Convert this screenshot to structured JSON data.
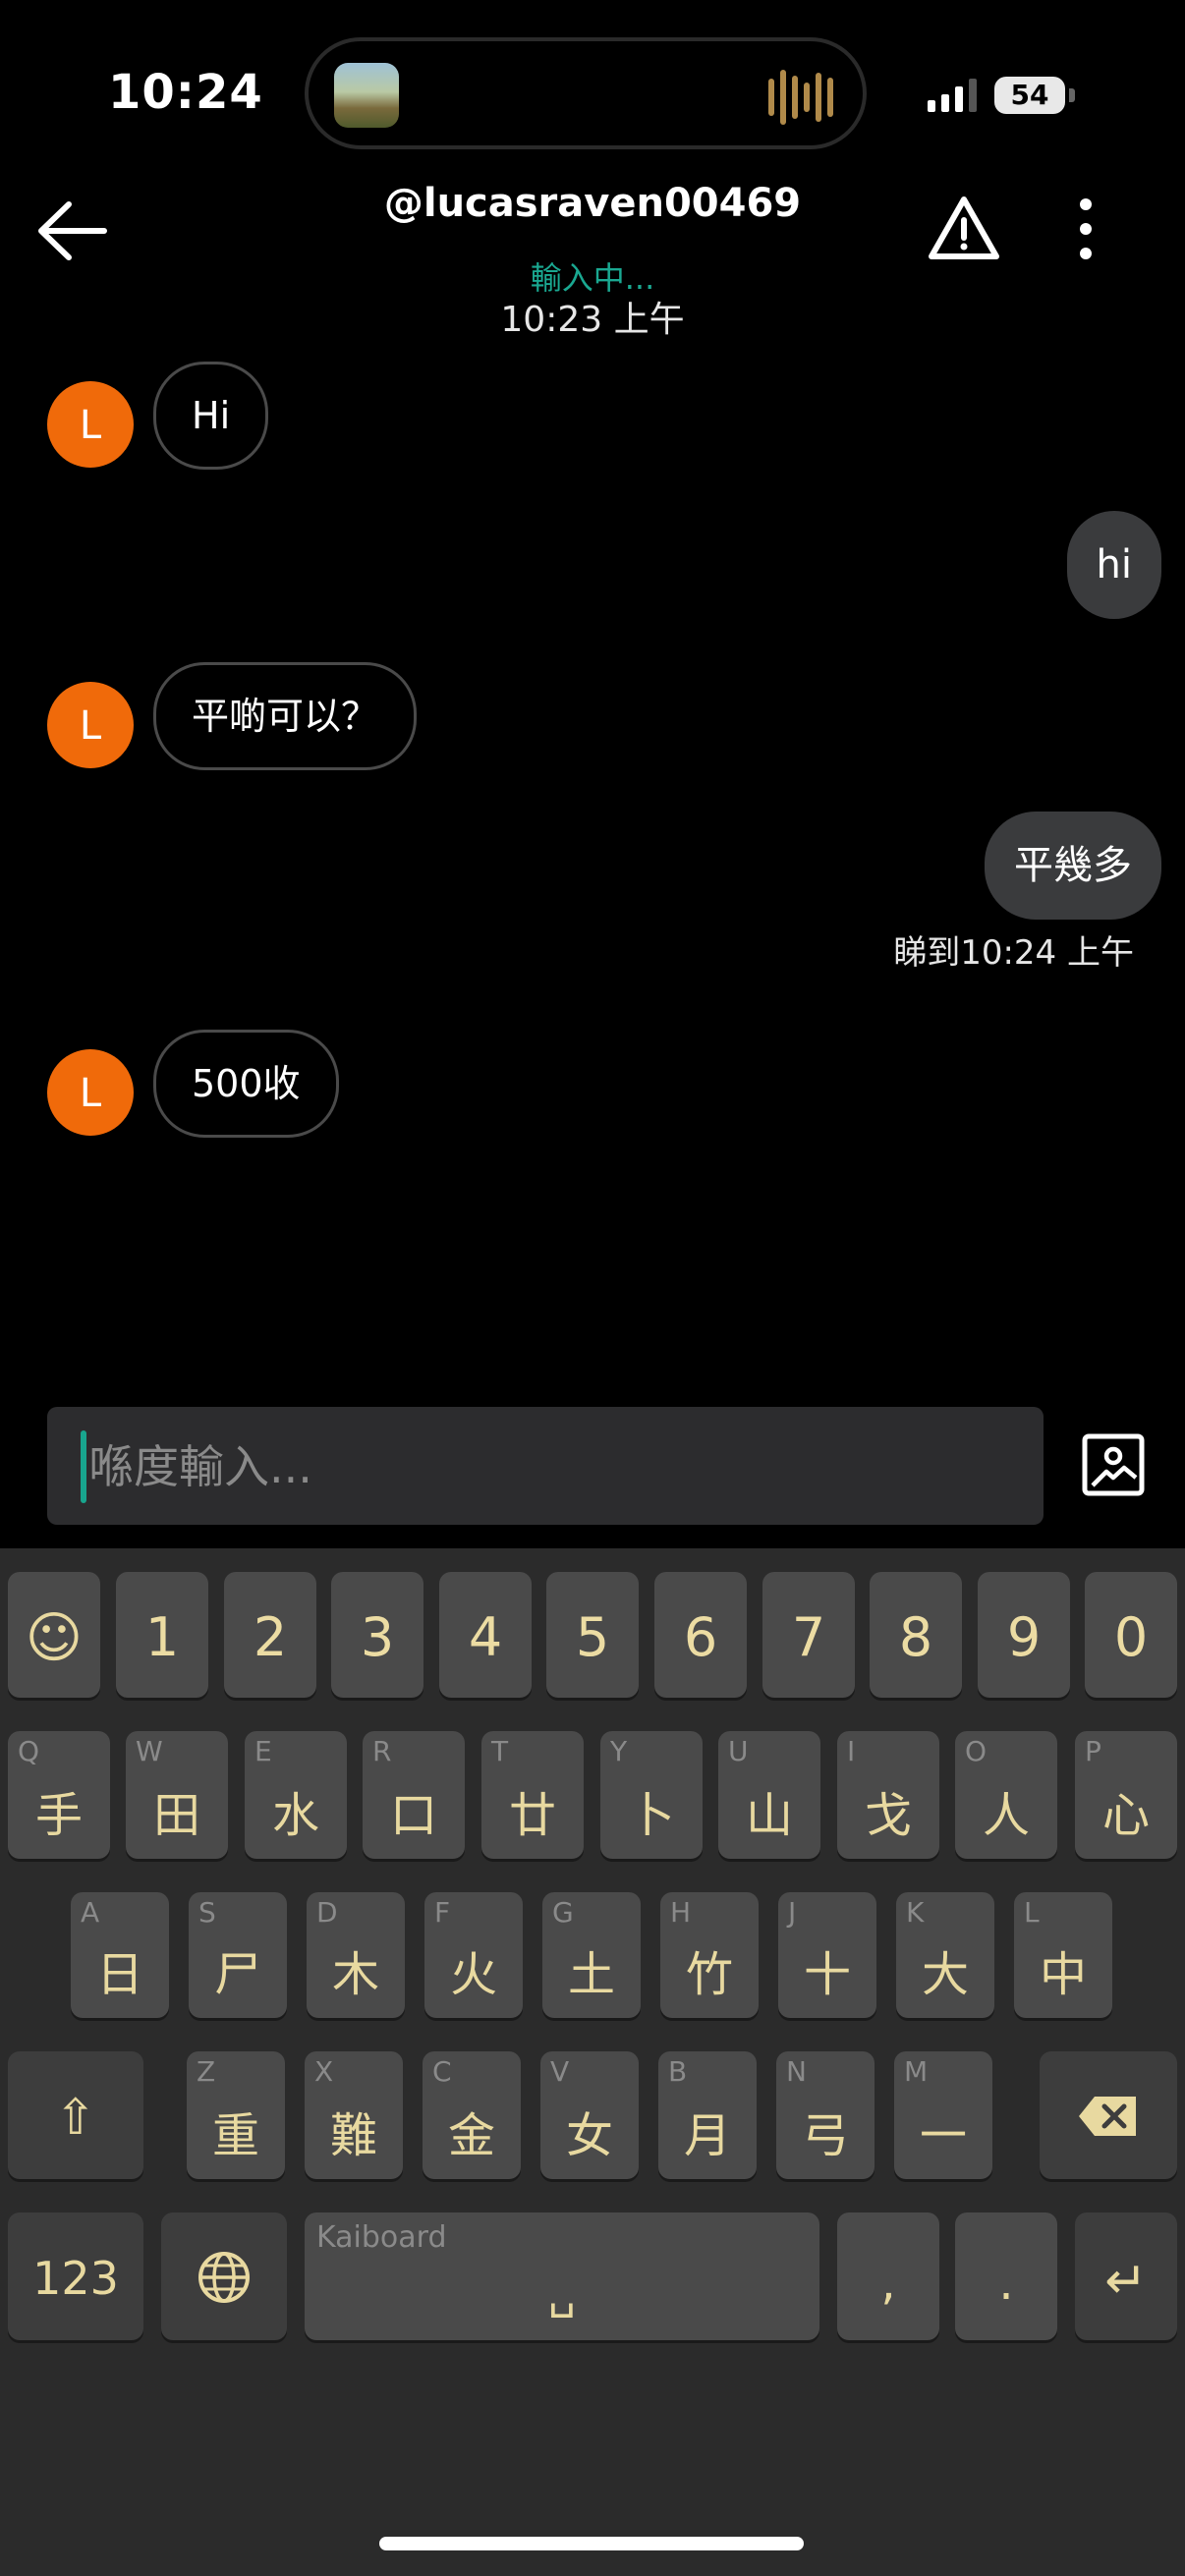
{
  "status_bar": {
    "time": "10:24",
    "battery": "54"
  },
  "header": {
    "title": "@lucasraven00469",
    "typing_status": "輸入中...",
    "timestamp": "10:23 上午"
  },
  "messages": [
    {
      "side": "in",
      "avatar": "L",
      "text": "Hi"
    },
    {
      "side": "out",
      "text": "hi"
    },
    {
      "side": "in",
      "avatar": "L",
      "text": "平啲可以？"
    },
    {
      "side": "out",
      "text": "平幾多"
    },
    {
      "side": "in",
      "avatar": "L",
      "text": "500收"
    }
  ],
  "read_receipt": "睇到10:24 上午",
  "composer": {
    "placeholder": "喺度輸入..."
  },
  "keyboard": {
    "emoji": "☺",
    "numbers": [
      "1",
      "2",
      "3",
      "4",
      "5",
      "6",
      "7",
      "8",
      "9",
      "0"
    ],
    "row1": [
      {
        "alt": "Q",
        "main": "手"
      },
      {
        "alt": "W",
        "main": "田"
      },
      {
        "alt": "E",
        "main": "水"
      },
      {
        "alt": "R",
        "main": "口"
      },
      {
        "alt": "T",
        "main": "廿"
      },
      {
        "alt": "Y",
        "main": "卜"
      },
      {
        "alt": "U",
        "main": "山"
      },
      {
        "alt": "I",
        "main": "戈"
      },
      {
        "alt": "O",
        "main": "人"
      },
      {
        "alt": "P",
        "main": "心"
      }
    ],
    "row2": [
      {
        "alt": "A",
        "main": "日"
      },
      {
        "alt": "S",
        "main": "尸"
      },
      {
        "alt": "D",
        "main": "木"
      },
      {
        "alt": "F",
        "main": "火"
      },
      {
        "alt": "G",
        "main": "土"
      },
      {
        "alt": "H",
        "main": "竹"
      },
      {
        "alt": "J",
        "main": "十"
      },
      {
        "alt": "K",
        "main": "大"
      },
      {
        "alt": "L",
        "main": "中"
      }
    ],
    "row3": [
      {
        "alt": "Z",
        "main": "重"
      },
      {
        "alt": "X",
        "main": "難"
      },
      {
        "alt": "C",
        "main": "金"
      },
      {
        "alt": "V",
        "main": "女"
      },
      {
        "alt": "B",
        "main": "月"
      },
      {
        "alt": "N",
        "main": "弓"
      },
      {
        "alt": "M",
        "main": "一"
      }
    ],
    "shift": "⇧",
    "backspace": "✕",
    "mode_key": "123",
    "globe": "🌐",
    "space_label": "Kaiboard",
    "space_glyph": "␣",
    "comma": ",",
    "period": ".",
    "return": "↵"
  }
}
